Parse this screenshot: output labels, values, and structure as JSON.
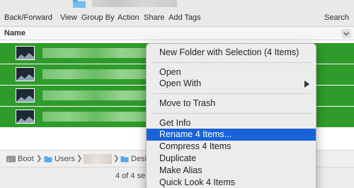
{
  "toolbar": {
    "back_forward": "Back/Forward",
    "view": "View",
    "group_by": "Group By",
    "action": "Action",
    "share": "Share",
    "add_tags": "Add Tags",
    "search": "Search"
  },
  "columns": {
    "name": "Name"
  },
  "files": {
    "count_selected": 4
  },
  "context_menu": {
    "items": [
      {
        "label": "New Folder with Selection (4 Items)"
      },
      {
        "label": "Open"
      },
      {
        "label": "Open With"
      },
      {
        "label": "Move to Trash"
      },
      {
        "label": "Get Info"
      },
      {
        "label": "Rename 4 Items..."
      },
      {
        "label": "Compress 4 Items"
      },
      {
        "label": "Duplicate"
      },
      {
        "label": "Make Alias"
      },
      {
        "label": "Quick Look 4 Items"
      }
    ],
    "highlighted": "Rename 4 Items..."
  },
  "pathbar": {
    "drive": "Boot",
    "users": "Users",
    "desktop": "Desk"
  },
  "status": {
    "text": "4 of 4 se"
  },
  "colors": {
    "selection": "#2f9b2a",
    "menu_highlight": "#1a63d6",
    "folder": "#5aa9e6"
  }
}
